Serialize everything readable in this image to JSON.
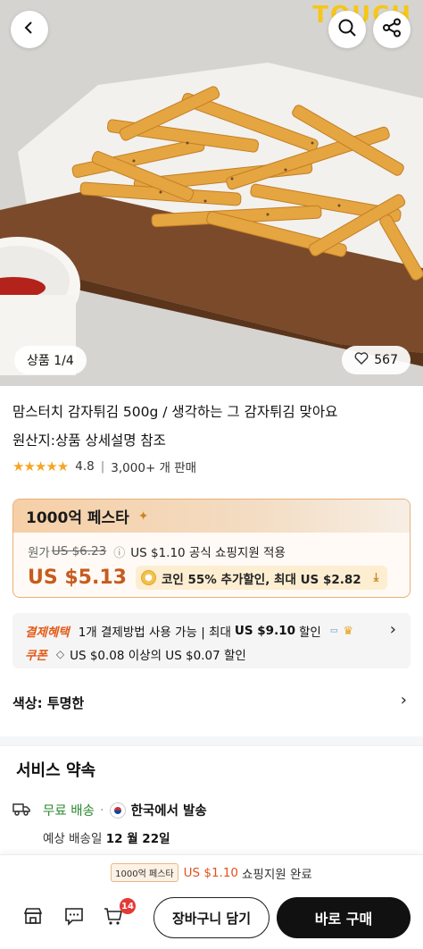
{
  "hero": {
    "logo_text": "TOUCH",
    "page_indicator": "상품 1/4",
    "like_count": "567"
  },
  "icons": {
    "back": "chevron-left-icon",
    "search": "search-icon",
    "share": "share-icon",
    "heart": "heart-icon"
  },
  "product": {
    "title_line1": "맘스터치 감자튀김 500g / 생각하는 그 감자튀김 맞아요",
    "title_line2": "원산지:상품 상세설명 참조",
    "stars": "★★★★★",
    "rating": "4.8",
    "sold": "3,000+ 개 판매"
  },
  "price": {
    "promo_title": "1000억 페스타",
    "original_label": "원가",
    "original_price": "US $6.23",
    "support_text": "US $1.10 공식 쇼핑지원 적용",
    "sale_price": "US $5.13",
    "coin_text": "코인 55% 추가할인, 최대 US $2.82"
  },
  "benefits": {
    "payment_label": "결제혜택",
    "payment_text": "1개 결제방법 사용 가능 | 최대",
    "payment_max": "US $9.10",
    "payment_suffix": "할인",
    "coupon_label": "쿠폰",
    "coupon_text": "US $0.08 이상의 US $0.07 할인"
  },
  "color": {
    "label": "색상: 투명한"
  },
  "service": {
    "title": "서비스 약속",
    "free_shipping": "무료 배송",
    "ship_from": "한국에서 발송",
    "eta_label": "예상 배송일",
    "eta_date": "12 월 22일"
  },
  "bottom": {
    "fest_badge": "1000억 페스타",
    "support_amount": "US $1.10",
    "support_done": "쇼핑지원 완료",
    "cart_count": "14",
    "add_cart": "장바구니 담기",
    "buy_now": "바로 구매"
  },
  "colors": {
    "accent_orange": "#c75b1e",
    "promo_border": "#e7b07a",
    "buy_button": "#111111",
    "badge_red": "#e53935"
  }
}
